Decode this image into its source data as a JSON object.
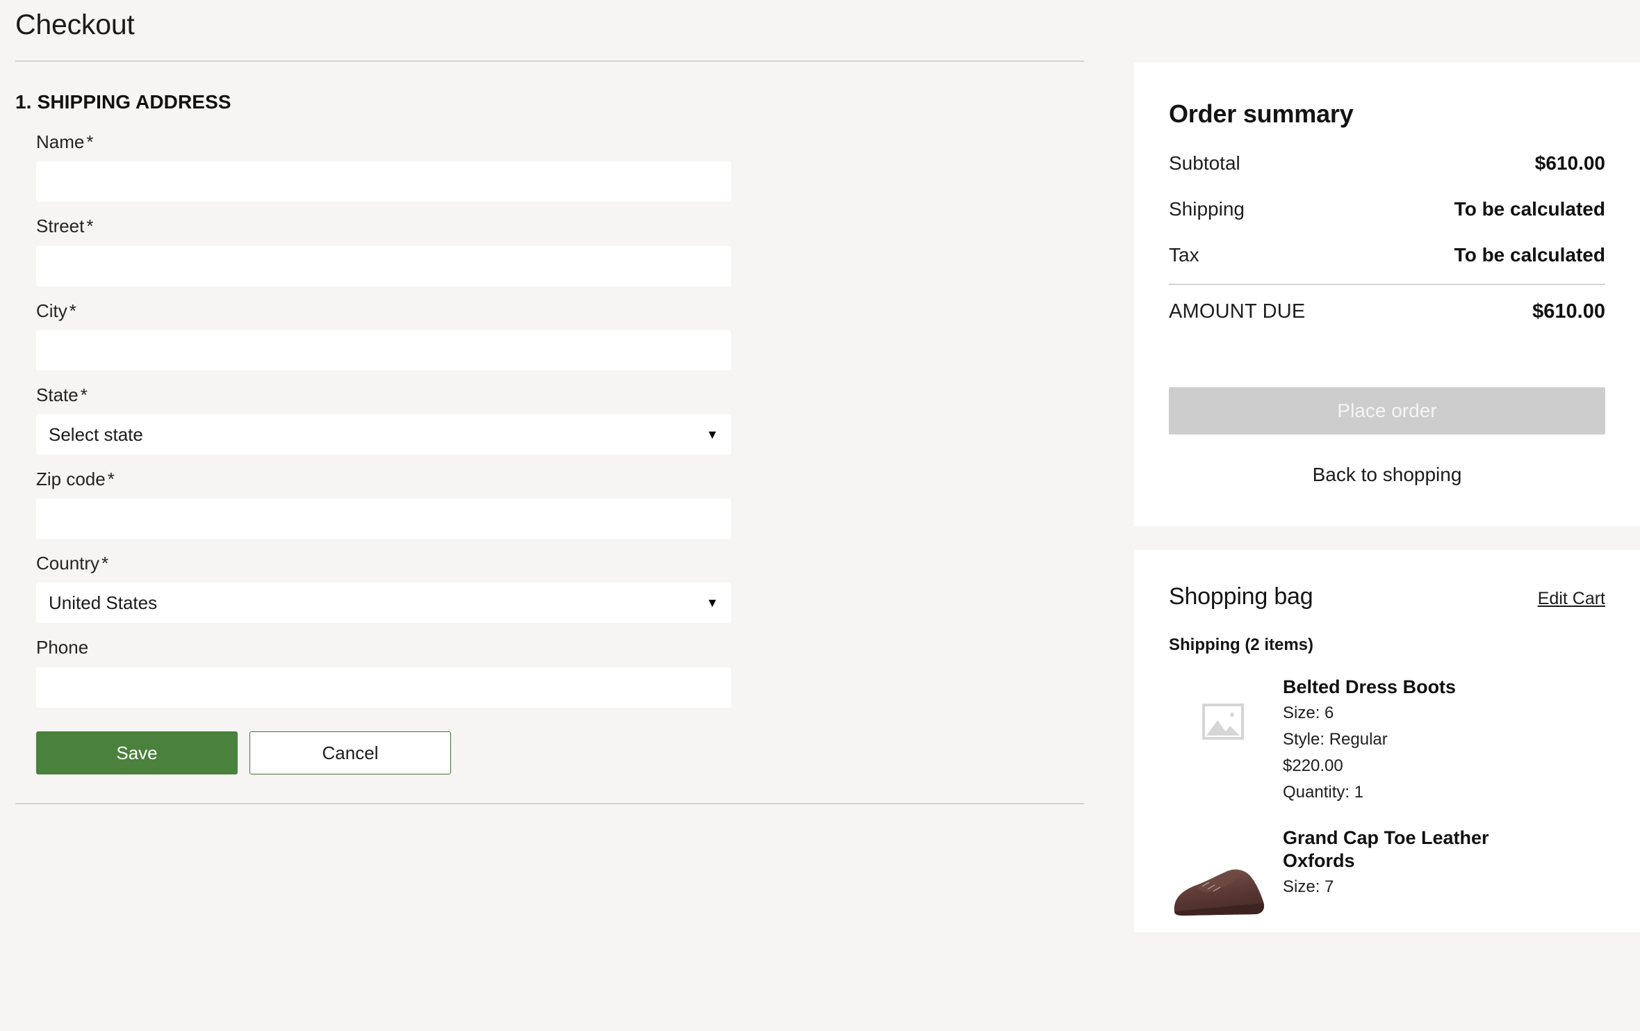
{
  "page": {
    "title": "Checkout"
  },
  "shipping_section": {
    "number": "1.",
    "heading": "SHIPPING ADDRESS",
    "fields": [
      {
        "label": "Name",
        "required": "*",
        "value": "",
        "placeholder": "",
        "type": "text"
      },
      {
        "label": "Street",
        "required": "*",
        "value": "",
        "placeholder": "",
        "type": "text"
      },
      {
        "label": "City",
        "required": "*",
        "value": "",
        "placeholder": "",
        "type": "text"
      },
      {
        "label": "State",
        "required": "*",
        "value": "Select state",
        "type": "select"
      },
      {
        "label": "Zip code",
        "required": "*",
        "value": "",
        "placeholder": "",
        "type": "text"
      },
      {
        "label": "Country",
        "required": "*",
        "value": "United States",
        "type": "select"
      },
      {
        "label": "Phone",
        "required": "",
        "value": "",
        "placeholder": "",
        "type": "text"
      }
    ],
    "save_label": "Save",
    "cancel_label": "Cancel"
  },
  "order_summary": {
    "title": "Order summary",
    "rows": [
      {
        "label": "Subtotal",
        "value": "$610.00"
      },
      {
        "label": "Shipping",
        "value": "To be calculated"
      },
      {
        "label": "Tax",
        "value": "To be calculated"
      }
    ],
    "total_label": "AMOUNT DUE",
    "total_value": "$610.00",
    "place_order_label": "Place order",
    "back_label": "Back to shopping"
  },
  "shopping_bag": {
    "title": "Shopping bag",
    "edit_label": "Edit Cart",
    "group_label": "Shipping (2 items)",
    "items": [
      {
        "name": "Belted Dress Boots",
        "size": "Size: 6",
        "style": "Style: Regular",
        "price": "$220.00",
        "quantity": "Quantity: 1",
        "image": "image-placeholder"
      },
      {
        "name": "Grand Cap Toe Leather Oxfords",
        "size": "Size: 7",
        "style": "",
        "price": "",
        "quantity": "",
        "image": "brown-oxford-shoe"
      }
    ]
  },
  "colors": {
    "background": "#f6f5f3",
    "save_green": "#4a813c",
    "place_order_disabled": "#cdcdcd",
    "divider": "#d2d2d2"
  }
}
